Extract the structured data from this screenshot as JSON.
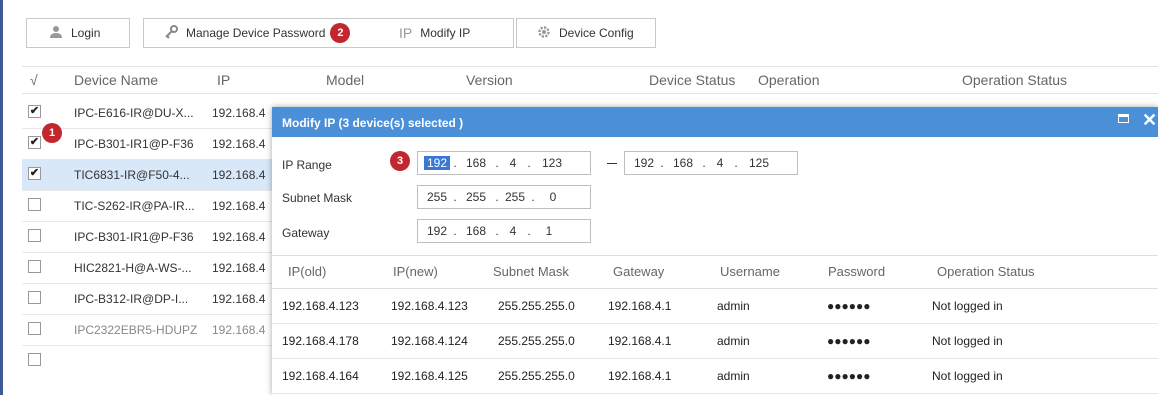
{
  "toolbar": {
    "login": "Login",
    "manage_password": "Manage Device Password",
    "modify_ip": "Modify IP",
    "device_config": "Device Config",
    "step_badge": "2"
  },
  "table": {
    "headers": {
      "check": "√",
      "name": "Device Name",
      "ip": "IP",
      "model": "Model",
      "version": "Version",
      "status": "Device Status",
      "operation": "Operation",
      "op_status": "Operation Status"
    },
    "rows": [
      {
        "checked": true,
        "name": "IPC-E616-IR@DU-X...",
        "ip": "192.168.4"
      },
      {
        "checked": true,
        "name": "IPC-B301-IR1@P-F36",
        "ip": "192.168.4"
      },
      {
        "checked": true,
        "name": "TIC6831-IR@F50-4...",
        "ip": "192.168.4"
      },
      {
        "checked": false,
        "name": "TIC-S262-IR@PA-IR...",
        "ip": "192.168.4"
      },
      {
        "checked": false,
        "name": "IPC-B301-IR1@P-F36",
        "ip": "192.168.4"
      },
      {
        "checked": false,
        "name": "HIC2821-H@A-WS-...",
        "ip": "192.168.4"
      },
      {
        "checked": false,
        "name": "IPC-B312-IR@DP-I...",
        "ip": "192.168.4"
      },
      {
        "checked": false,
        "name": "IPC2322EBR5-HDUPZ",
        "ip": "192.168.4"
      }
    ],
    "check_mark": "✔",
    "step_badge": "1"
  },
  "dialog": {
    "title": "Modify IP (3 device(s) selected )",
    "ip_range_label": "IP Range",
    "subnet_label": "Subnet Mask",
    "gateway_label": "Gateway",
    "step_badge": "3",
    "ip_start": [
      "192",
      "168",
      "4",
      "123"
    ],
    "ip_end": [
      "192",
      "168",
      "4",
      "125"
    ],
    "subnet": [
      "255",
      "255",
      "255",
      "0"
    ],
    "gateway": [
      "192",
      "168",
      "4",
      "1"
    ],
    "headers": {
      "ip_old": "IP(old)",
      "ip_new": "IP(new)",
      "subnet": "Subnet Mask",
      "gateway": "Gateway",
      "username": "Username",
      "password": "Password",
      "op_status": "Operation Status"
    },
    "rows": [
      {
        "ip_old": "192.168.4.123",
        "ip_new": "192.168.4.123",
        "subnet": "255.255.255.0",
        "gateway": "192.168.4.1",
        "username": "admin",
        "password": "●●●●●●",
        "status": "Not logged in"
      },
      {
        "ip_old": "192.168.4.178",
        "ip_new": "192.168.4.124",
        "subnet": "255.255.255.0",
        "gateway": "192.168.4.1",
        "username": "admin",
        "password": "●●●●●●",
        "status": "Not logged in"
      },
      {
        "ip_old": "192.168.4.164",
        "ip_new": "192.168.4.125",
        "subnet": "255.255.255.0",
        "gateway": "192.168.4.1",
        "username": "admin",
        "password": "●●●●●●",
        "status": "Not logged in"
      }
    ]
  },
  "colors": {
    "accent": "#4a8fd8",
    "badge": "#c1272d",
    "selected_row": "#d9e8f9"
  }
}
